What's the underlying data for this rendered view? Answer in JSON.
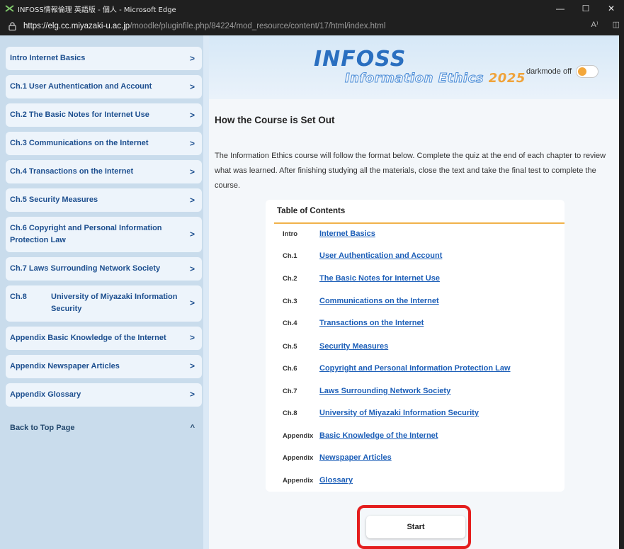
{
  "window": {
    "title": "INFOSS情報倫理 英語版 - 個人 - Microsoft Edge",
    "app_icon": "infoss-icon",
    "controls": {
      "minimize": "—",
      "maximize": "☐",
      "close": "✕"
    }
  },
  "address": {
    "url_host": "https://elg.cc.miyazaki-u.ac.jp",
    "url_path": "/moodle/pluginfile.php/84224/mod_resource/content/17/html/index.html",
    "icons": {
      "read_aloud": "A⁾",
      "split": "◫"
    }
  },
  "sidebar": {
    "items": [
      {
        "prefix": "Intro",
        "label": "Internet Basics"
      },
      {
        "prefix": "Ch.1",
        "label": "User Authentication and Account"
      },
      {
        "prefix": "Ch.2",
        "label": "The Basic Notes for Internet Use"
      },
      {
        "prefix": "Ch.3",
        "label": "Communications on the Internet"
      },
      {
        "prefix": "Ch.4",
        "label": "Transactions on the Internet"
      },
      {
        "prefix": "Ch.5",
        "label": "Security Measures"
      },
      {
        "prefix": "Ch.6",
        "label": "Copyright and Personal Information Protection Law"
      },
      {
        "prefix": "Ch.7",
        "label": "Laws Surrounding Network Society"
      },
      {
        "prefix": "Ch.8",
        "label": "University of Miyazaki Information Security"
      },
      {
        "prefix": "Appendix",
        "label": "Basic Knowledge of the Internet"
      },
      {
        "prefix": "Appendix",
        "label": "Newspaper Articles"
      },
      {
        "prefix": "Appendix",
        "label": "Glossary"
      }
    ],
    "back_to_top": "Back to Top Page",
    "chevron": ">",
    "up_chevron": "^"
  },
  "banner": {
    "logo": "INFOSS",
    "subtitle": "Information Ethics",
    "year": "2025",
    "darkmode_label": "darkmode off",
    "darkmode_on": false
  },
  "main": {
    "heading": "How the Course is Set Out",
    "intro": "The Information Ethics course will follow the format below. Complete the quiz at the end of each chapter to review what was learned. After finishing studying all the materials, close the text and take the final test to complete the course.",
    "toc_title": "Table of Contents",
    "toc": [
      {
        "prefix": "Intro",
        "label": "Internet Basics"
      },
      {
        "prefix": "Ch.1",
        "label": "User Authentication and Account"
      },
      {
        "prefix": "Ch.2",
        "label": "The Basic Notes for Internet Use"
      },
      {
        "prefix": "Ch.3",
        "label": "Communications on the Internet"
      },
      {
        "prefix": "Ch.4",
        "label": "Transactions on the Internet"
      },
      {
        "prefix": "Ch.5",
        "label": "Security Measures"
      },
      {
        "prefix": "Ch.6",
        "label": "Copyright and Personal Information Protection Law"
      },
      {
        "prefix": "Ch.7",
        "label": "Laws Surrounding Network Society"
      },
      {
        "prefix": "Ch.8",
        "label": "University of Miyazaki Information Security"
      },
      {
        "prefix": "Appendix",
        "label": "Basic Knowledge of the Internet"
      },
      {
        "prefix": "Appendix",
        "label": "Newspaper Articles"
      },
      {
        "prefix": "Appendix",
        "label": "Glossary"
      }
    ],
    "start_label": "Start"
  },
  "colors": {
    "link": "#1d5fb8",
    "sidebar_text": "#1d4f8f",
    "accent_orange": "#f1b24a",
    "highlight_red": "#e41d1d"
  }
}
